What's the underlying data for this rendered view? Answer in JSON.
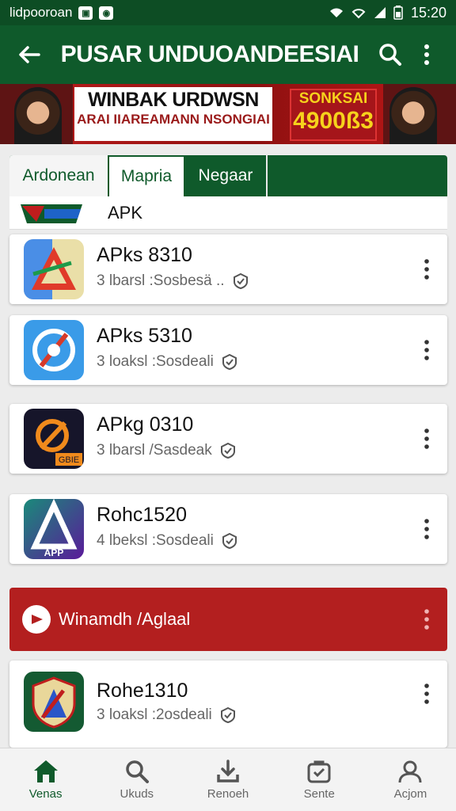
{
  "status_bar": {
    "carrier": "lidpooroan",
    "time": "15:20"
  },
  "app_bar": {
    "title": "PUSAR UNDUOANDEESIAI"
  },
  "banner": {
    "headline": "WINBAK URDWSN",
    "subline": "ARAI IIAREAMANN NSONGIAI",
    "promo_label": "SONKSAI",
    "promo_value": "4900ß3"
  },
  "tabs": [
    {
      "label": "Ardonean"
    },
    {
      "label": "Mapria"
    },
    {
      "label": "Negaar"
    }
  ],
  "category": {
    "label": "APK"
  },
  "apps": [
    {
      "name": "APks 8310",
      "meta": "3 lbarsl :Sosbesä .."
    },
    {
      "name": "APks 5310",
      "meta": "3 loaksl :Sosdeali"
    },
    {
      "name": "APkg 0310",
      "meta": "3 lbarsl /Sasdeak"
    },
    {
      "name": "Rohc1520",
      "meta": "4 lbeksl :Sosdeali"
    },
    {
      "name": "Rohe1310",
      "meta": "3 loaksl :2osdeali"
    }
  ],
  "app_icons": [
    "triangle-app-icon",
    "compass-app-icon",
    "orange-game-icon",
    "purple-apk-icon",
    "shield-app-icon"
  ],
  "app3_icon_label": "GBIE",
  "app4_icon_label": "APP",
  "promo": {
    "label": "Winamdh /Aglaal"
  },
  "bottom_nav": [
    {
      "label": "Venas"
    },
    {
      "label": "Ukuds"
    },
    {
      "label": "Renoeh"
    },
    {
      "label": "Sente"
    },
    {
      "label": "Acjom"
    }
  ],
  "colors": {
    "primary": "#0f5a2b",
    "statusbar": "#0d4d24",
    "promo": "#b31f1f",
    "banner": "#c01d1d"
  }
}
